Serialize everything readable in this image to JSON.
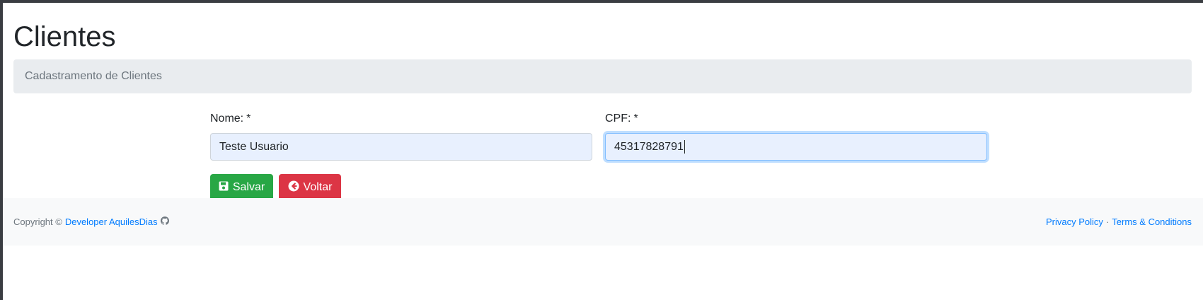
{
  "page": {
    "title": "Clientes",
    "breadcrumb": "Cadastramento de Clientes"
  },
  "form": {
    "nome": {
      "label": "Nome:",
      "required_mark": "*",
      "value": "Teste Usuario"
    },
    "cpf": {
      "label": "CPF:",
      "required_mark": "*",
      "value": "45317828791"
    }
  },
  "actions": {
    "save_label": "Salvar",
    "back_label": "Voltar",
    "save_icon": "floppy-disk-icon",
    "back_icon": "arrow-circle-left-icon"
  },
  "footer": {
    "copyright": "Copyright ©",
    "developer_link": "Developer AquilesDias",
    "developer_icon": "github-icon",
    "privacy_link": "Privacy Policy",
    "separator": "·",
    "terms_link": "Terms & Conditions"
  },
  "colors": {
    "success": "#28a745",
    "danger": "#dc3545",
    "link": "#007bff",
    "breadcrumb_bg": "#e9ecef",
    "footer_bg": "#f8f9fa",
    "autofill_bg": "#e8f0fe"
  }
}
